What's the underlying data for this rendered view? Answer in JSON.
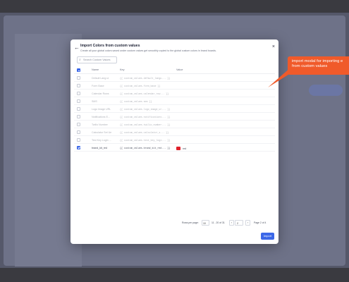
{
  "modal": {
    "title": "Import Colors from custom values",
    "subtitle": "Create all your global colors saved under custom values get smoothly copied to the global custom colors in brand boards.",
    "search_placeholder": "Search Custom Values",
    "columns": {
      "name": "Name",
      "key": "Key",
      "value": "Value"
    },
    "rows": [
      {
        "name": "Default Lang ui",
        "key": "{{ custom_values.default_langu... }}",
        "value": "",
        "swatch": "",
        "checked": false
      },
      {
        "name": "Form Base",
        "key": "{{ custom_values.form_base }}",
        "value": "",
        "swatch": "",
        "checked": false
      },
      {
        "name": "Calendar Rows",
        "key": "{{ custom_values.calendar_row... }}",
        "value": "",
        "swatch": "",
        "checked": false
      },
      {
        "name": "SMS",
        "key": "{{ custom_values.sms }}",
        "value": "",
        "swatch": "",
        "checked": false
      },
      {
        "name": "Logo Image URL",
        "key": "{{ custom_values.logo_image_ur... }}",
        "value": "",
        "swatch": "",
        "checked": false
      },
      {
        "name": "Notifications E...",
        "key": "{{ custom_values.notifications... }}",
        "value": "",
        "swatch": "",
        "checked": false
      },
      {
        "name": "Twilio Number",
        "key": "{{ custom_values.twilio_number... }}",
        "value": "",
        "swatch": "",
        "checked": false
      },
      {
        "name": "Calculator Set Ue",
        "key": "{{ custom_values.calculator_s... }}",
        "value": "",
        "swatch": "",
        "checked": false
      },
      {
        "name": "Test Key Login ...",
        "key": "{{ custom_values.test_key_logi... }}",
        "value": "",
        "swatch": "",
        "checked": false
      },
      {
        "name": "brand_kit_red",
        "key": "{{ custom_values.brand_kit_red... }}",
        "value": "red",
        "swatch": "#e0202a",
        "checked": true
      }
    ],
    "pagination": {
      "per_page_label": "Rows per page:",
      "per_page_value": "10",
      "range_text": "11 - 20 of 31",
      "prev": "‹",
      "page_value": "2",
      "next": "›",
      "page_of": "Page 2 of 4"
    },
    "import_label": "Import"
  },
  "callout": {
    "line1": "import modal for importing e",
    "line2": "from custom values",
    "color": "#f05a2a"
  },
  "icons": {
    "back": "←",
    "close": "×",
    "search": "⌕"
  }
}
